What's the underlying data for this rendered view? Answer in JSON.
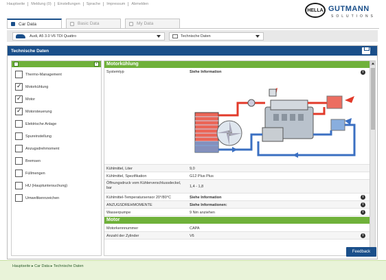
{
  "topnav": {
    "links": [
      "Hauptseite",
      "Meldung (0)",
      "Einstellungen",
      "Sprache",
      "Impressum",
      "Abmelden"
    ]
  },
  "brand": {
    "mark": "HELLA",
    "name": "GUTMANN",
    "sub": "SOLUTIONS"
  },
  "tabs": [
    {
      "label": "Car Data",
      "active": true
    },
    {
      "label": "Basic Data",
      "active": false
    },
    {
      "label": "My Data",
      "active": false
    }
  ],
  "selectors": {
    "vehicle": "Audi, A5 3.0 V6 TDI Quattro",
    "category": "Technische Daten"
  },
  "panel": {
    "title": "Technische Daten"
  },
  "left_list": {
    "items": [
      {
        "label": "Thermo-Management",
        "checked": false
      },
      {
        "label": "Motorkühlung",
        "checked": true
      },
      {
        "label": "Motor",
        "checked": true
      },
      {
        "label": "Motorsteuerung",
        "checked": true
      },
      {
        "label": "Elektrische Anlage",
        "checked": false
      },
      {
        "label": "Spureinstellung",
        "checked": false
      },
      {
        "label": "Anzugsdrehmoment",
        "checked": false
      },
      {
        "label": "Bremsen",
        "checked": false
      },
      {
        "label": "Füllmengen",
        "checked": false
      },
      {
        "label": "HU (Hauptuntersuchung)",
        "checked": false
      },
      {
        "label": "Umweltkennzeichen",
        "checked": false
      }
    ]
  },
  "right": {
    "section1": "Motorkühlung",
    "systemtyp_label": "Systemtyp",
    "systemtyp_value": "Siehe Information",
    "rows": [
      {
        "label": "Kühlmittel, Liter",
        "value": "9,0",
        "bold": false,
        "info": false
      },
      {
        "label": "Kühlmittel, Spezifikation",
        "value": "G12 Plus Plus",
        "bold": false,
        "info": false
      },
      {
        "label": "Öffnungsdruck vom Kühlerverschlussdeckel, bar",
        "value": "1,4 - 1,8",
        "bold": false,
        "info": false
      },
      {
        "label": "Kühlmittel-Temperatursensor 20°/80°C",
        "value": "Siehe Information",
        "bold": true,
        "info": true
      },
      {
        "label": "ANZUGSDREHMOMENTE",
        "value": "Siehe Informationen:",
        "bold": true,
        "info": true
      },
      {
        "label": "Wasserpumpe",
        "value": "9 Nm anziehen",
        "bold": false,
        "info": false
      }
    ],
    "section2": "Motor",
    "rows2": [
      {
        "label": "Motorkennnummer",
        "value": "CAPA"
      },
      {
        "label": "Anzahl der Zylinder",
        "value": "V6"
      }
    ]
  },
  "feedback_label": "Feedback",
  "breadcrumb": "Hauptseite ▸ Car Data ▸ Technische Daten",
  "colors": {
    "accent": "#1a4f8a",
    "green": "#6fb13a",
    "footer": "#e9f3d9"
  }
}
